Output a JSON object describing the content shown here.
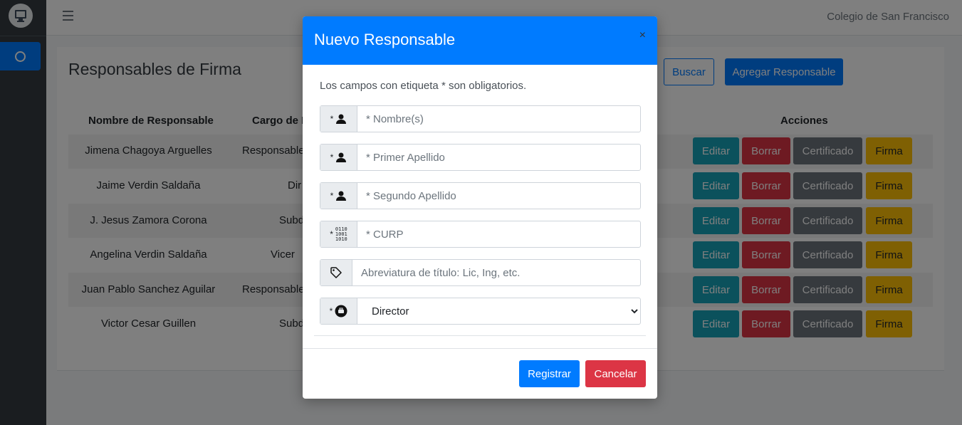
{
  "navbar": {
    "school_name": "Colegio de San Francisco"
  },
  "page": {
    "title": "Responsables de Firma",
    "buscar_label": "Buscar",
    "agregar_label": "Agregar Responsable"
  },
  "table": {
    "headers": [
      "Nombre de Responsable",
      "Cargo de R",
      "Acciones"
    ],
    "rows": [
      {
        "name": "Jimena Chagoya Arguelles",
        "cargo": "Responsable"
      },
      {
        "name": "Jaime Verdin Saldaña",
        "cargo": "Dir"
      },
      {
        "name": "J. Jesus Zamora Corona",
        "cargo": "Subd"
      },
      {
        "name": "Angelina Verdin Saldaña",
        "cargo": "Vicer"
      },
      {
        "name": "Juan Pablo Sanchez Aguilar",
        "cargo": "Responsable"
      },
      {
        "name": "Victor Cesar Guillen",
        "cargo": "Subd"
      }
    ],
    "actions": {
      "edit": "Editar",
      "delete": "Borrar",
      "cert": "Certificado",
      "firma": "Firma"
    }
  },
  "modal": {
    "title": "Nuevo Responsable",
    "close": "×",
    "note": "Los campos con etiqueta * son obligatorios.",
    "star": "*",
    "binary": [
      "0110",
      "1001",
      "1010"
    ],
    "fields": {
      "nombre": "* Nombre(s)",
      "primer_apellido": "* Primer Apellido",
      "segundo_apellido": "* Segundo Apellido",
      "curp": "* CURP",
      "abreviatura": "Abreviatura de título: Lic, Ing, etc."
    },
    "cargo_selected": "Director",
    "registrar_label": "Registrar",
    "cancelar_label": "Cancelar"
  },
  "colors": {
    "primary": "#007bff",
    "danger": "#dc3545",
    "info": "#17a2b8",
    "secondary": "#6c757d",
    "warning": "#ffc107",
    "sidebar": "#343a40"
  }
}
